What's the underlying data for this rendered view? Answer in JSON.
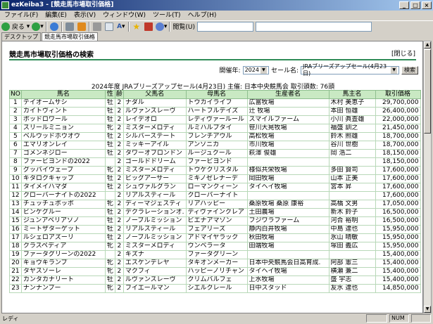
{
  "window": {
    "title": "ezKeiba3 - [競走馬市場取引価格]"
  },
  "menu": [
    "ファイル(F)",
    "編集(E)",
    "表示(V)",
    "ウィンドウ(W)",
    "ツール(T)",
    "ヘルプ(H)"
  ],
  "toolbar": {
    "back_label": "戻る",
    "address_label": "閲覧(U)"
  },
  "tabs": [
    "デスクトップ",
    "競走馬市場取引価格"
  ],
  "page": {
    "title": "競走馬市場取引価格の検索",
    "close": "[閉じる]",
    "year_label": "開催年:",
    "year_value": "2024",
    "sale_label": "セール名:",
    "sale_value": "JRAブリーズアップセール(4月23日)",
    "search_button": "検索",
    "info": "2024年度 JRAブリーズアップセール(4月23日) 主催: 日本中央競馬会 取引頭数: 76頭"
  },
  "table": {
    "headers": [
      "NO",
      "馬名",
      "性",
      "齢",
      "父馬名",
      "母馬名",
      "生産者名",
      "馬主名",
      "取引価格"
    ],
    "rows": [
      [
        "1",
        "テイオームサシ",
        "牡",
        "2",
        "ナダル",
        "トウカイライフ",
        "広富牧場",
        "木村 美恵子",
        "29,700,000"
      ],
      [
        "2",
        "カイトヴィント",
        "牡",
        "2",
        "ルヴァンスレーヴ",
        "ハートフルデイズ",
        "辻 牧場",
        "本田 恒雄",
        "26,400,000"
      ],
      [
        "3",
        "ボッドロワール",
        "牡",
        "2",
        "レイデオロ",
        "レディヴァールール",
        "スマイルファーム",
        "小川 眞査雄",
        "22,000,000"
      ],
      [
        "4",
        "スリールミニョン",
        "牝",
        "2",
        "ミスターメロディ",
        "ルミハルプタイ",
        "笹川大晃牧場",
        "福盛 訓之",
        "21,450,000"
      ],
      [
        "5",
        "ベルウッドホウオウ",
        "牡",
        "2",
        "シルバーステート",
        "フレンチアウル",
        "高松牧場",
        "鈴木 照雄",
        "18,700,000"
      ],
      [
        "6",
        "エマリオンレイ",
        "牡",
        "2",
        "ミッキーアイル",
        "アンソニカ",
        "市川牧場",
        "谷川 世樹",
        "18,700,000"
      ],
      [
        "7",
        "ゴメンネジロー",
        "牡",
        "2",
        "タワーオブロンドン",
        "ルージュクール",
        "萩澤 俊雄",
        "岡 浩二",
        "18,150,000"
      ],
      [
        "8",
        "ファービヨンドの2022",
        "",
        "2",
        "ゴールドドリーム",
        "ファービヨンド",
        "",
        "",
        "18,150,000"
      ],
      [
        "9",
        "グッバイウェーブ",
        "牝",
        "2",
        "ミスターメロディ",
        "トウケクリスタル",
        "様似共栄牧場",
        "多田 賢司",
        "17,600,000"
      ],
      [
        "10",
        "キタロクキャップ",
        "牡",
        "2",
        "ビッグアーサー",
        "ミキノゼレナーデ",
        "岡田牧場",
        "山本 正美",
        "17,600,000"
      ],
      [
        "11",
        "タイメイハマダ",
        "牡",
        "2",
        "シュヴァルグラン",
        "ローマンクィーン",
        "タイヘイ牧場",
        "宮本 昇",
        "17,600,000"
      ],
      [
        "12",
        "クローバーナイトの2022",
        "",
        "2",
        "リアルスティール",
        "クローバーナイト",
        "",
        "",
        "17,600,000"
      ],
      [
        "13",
        "チュッチュボッボ",
        "牝",
        "2",
        "ディーマジェスティ",
        "リアハッピー",
        "桑原牧場 桑原 康裕",
        "高橋 文男",
        "17,050,000"
      ],
      [
        "14",
        "ビンケグルー",
        "牡",
        "2",
        "デクラレーションオ.",
        "ディヴァインクレア",
        "土田農場",
        "新木 鈴子",
        "16,500,000"
      ],
      [
        "15",
        "ジュンアベリアソノ",
        "牡",
        "2",
        "ノーブルミッション",
        "ビエナアマゾン",
        "フジワラファーム",
        "河合 裕明",
        "16,500,000"
      ],
      [
        "16",
        "ミートザターゲット",
        "牡",
        "2",
        "リアルスティール",
        "フェアリーズ",
        "静内白井牧場",
        "中島 達也",
        "15,950,000"
      ],
      [
        "17",
        "ルシェロアズーリ",
        "牡",
        "2",
        "ノーブルミッション",
        "アドマイヤラック",
        "秋田牧場",
        "氷山 晴敏",
        "15,950,000"
      ],
      [
        "18",
        "クラスペディア",
        "牝",
        "2",
        "ミスターメロディ",
        "ウンベラータ",
        "田端牧場",
        "塚田 義広",
        "15,950,000"
      ],
      [
        "19",
        "ファータグリーンの2022",
        "",
        "2",
        "キズナ",
        "ファータグリーン",
        "",
        "",
        "15,400,000"
      ],
      [
        "20",
        "キョウキランプ",
        "牝",
        "2",
        "エスケンデレヤ",
        "タキオンメーカー",
        "日本中央競馬会日高育成.",
        "阿部 憲三",
        "15,400,000"
      ],
      [
        "21",
        "タヤスソーレ",
        "牝",
        "2",
        "マクフィ",
        "ハッピーノリチャン",
        "タイヘイ牧場",
        "横瀬 兼二",
        "15,400,000"
      ],
      [
        "22",
        "カンタカナリート",
        "牡",
        "2",
        "ルヴァンスレーヴ",
        "クリムバルフェ",
        "上水牧場",
        "盛 宇志",
        "15,400,000"
      ],
      [
        "23",
        "ナンナンプー",
        "牝",
        "2",
        "フイエールマン",
        "シエルクレール",
        "日中スタッド",
        "友水 達也",
        "14,850,000"
      ]
    ]
  },
  "status": {
    "text": "レディ",
    "num": "NUM"
  }
}
